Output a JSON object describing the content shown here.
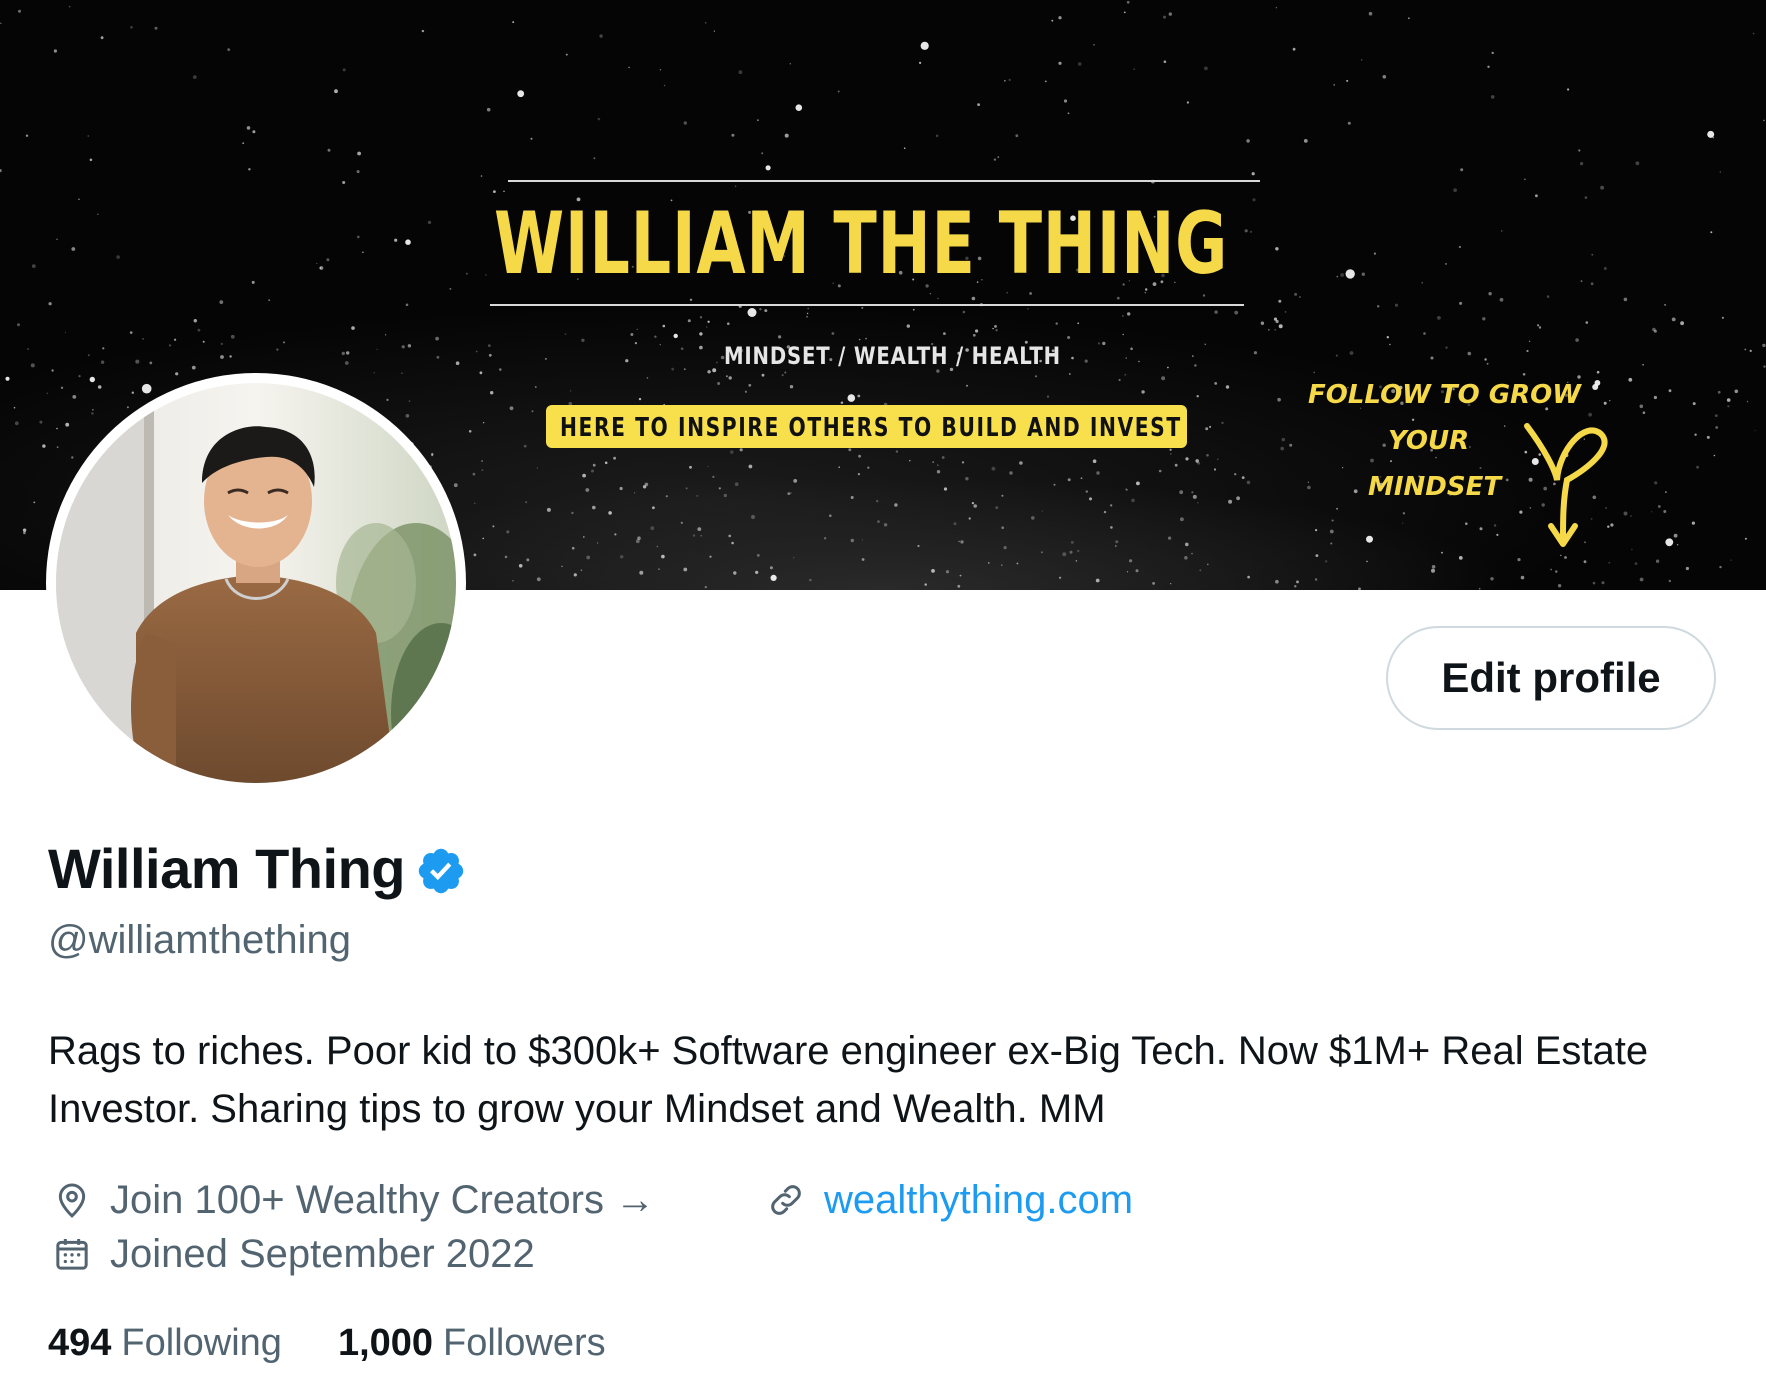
{
  "banner": {
    "title": "WILLIAM THE THING",
    "subtitle": "MINDSET / WEALTH / HEALTH",
    "tagline": "HERE TO INSPIRE OTHERS TO BUILD AND INVEST",
    "cta_line1": "FOLLOW TO GROW",
    "cta_line2": "YOUR",
    "cta_line3": "MINDSET",
    "title_color": "#f5d949",
    "pill_color": "#f7e04b"
  },
  "profile": {
    "name": "William Thing",
    "handle": "@williamthething",
    "verified": true,
    "verified_icon": "verified-badge-icon",
    "bio": "Rags to riches. Poor kid to $300k+ Software engineer ex-Big Tech. Now $1M+ Real Estate Investor. Sharing tips to grow your Mindset and Wealth. MM",
    "location": "Join 100+ Wealthy Creators →",
    "location_icon": "location-pin-icon",
    "website": "wealthything.com",
    "website_icon": "link-icon",
    "joined": "Joined September 2022",
    "joined_icon": "calendar-icon"
  },
  "actions": {
    "edit_profile_label": "Edit profile"
  },
  "stats": {
    "following_count": "494",
    "following_label": "Following",
    "followers_count": "1,000",
    "followers_label": "Followers"
  },
  "colors": {
    "accent": "#1d9bf0",
    "secondary_text": "#536471",
    "primary_text": "#0f1419"
  }
}
